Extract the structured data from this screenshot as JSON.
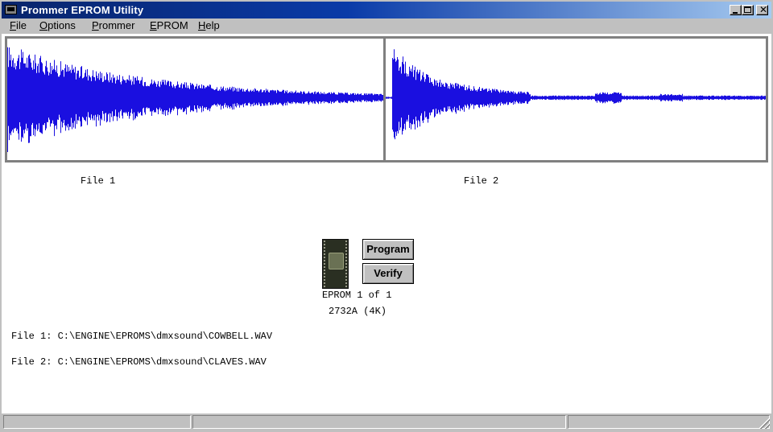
{
  "window": {
    "title": "Prommer EPROM Utility"
  },
  "menu": [
    {
      "underline": "F",
      "rest": "ile"
    },
    {
      "underline": "O",
      "rest": "ptions"
    },
    {
      "underline": "P",
      "rest": "rommer"
    },
    {
      "underline": "E",
      "rest": "PROM"
    },
    {
      "underline": "H",
      "rest": "elp"
    }
  ],
  "waveforms": {
    "file1_label": "File 1",
    "file2_label": "File 2",
    "wave_color": "#1a0fe0"
  },
  "eprom": {
    "count_text": "EPROM 1 of 1",
    "type_text": "2732A (4K)",
    "chip_icon": "eprom-chip-icon"
  },
  "buttons": {
    "program_label": "Program",
    "verify_label": "Verify"
  },
  "files": {
    "file1_path": "File 1: C:\\ENGINE\\EPROMS\\dmxsound\\COWBELL.WAV",
    "file2_path": "File 2: C:\\ENGINE\\EPROMS\\dmxsound\\CLAVES.WAV"
  },
  "statusbar": {
    "panel1": "",
    "panel2": "",
    "panel3": ""
  }
}
